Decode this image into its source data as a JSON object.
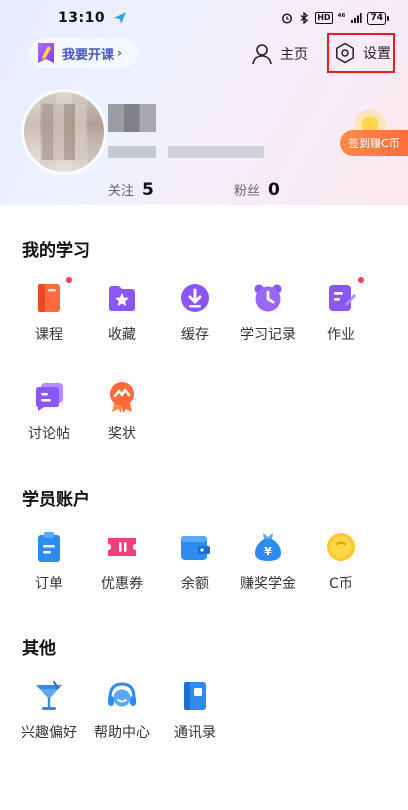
{
  "status_bar": {
    "time": "13:10",
    "hd": "HD",
    "signal": "⁴⁶",
    "battery": "74"
  },
  "header": {
    "teach_label": "我要开课",
    "home_label": "主页",
    "settings_label": "设置"
  },
  "profile": {
    "checkin_label": "签到赚C币",
    "follow_label": "关注",
    "follow_count": "5",
    "fans_label": "粉丝",
    "fans_count": "0"
  },
  "sections": [
    {
      "title": "我的学习",
      "items": [
        {
          "label": "课程",
          "icon": "course-book-icon",
          "badge": true
        },
        {
          "label": "收藏",
          "icon": "star-folder-icon",
          "badge": false
        },
        {
          "label": "缓存",
          "icon": "download-icon",
          "badge": false
        },
        {
          "label": "学习记录",
          "icon": "alarm-clock-icon",
          "badge": false
        },
        {
          "label": "作业",
          "icon": "homework-icon",
          "badge": true
        },
        {
          "label": "讨论帖",
          "icon": "chat-bubble-icon",
          "badge": false
        },
        {
          "label": "奖状",
          "icon": "medal-icon",
          "badge": false
        }
      ]
    },
    {
      "title": "学员账户",
      "items": [
        {
          "label": "订单",
          "icon": "clipboard-icon",
          "badge": false
        },
        {
          "label": "优惠券",
          "icon": "coupon-icon",
          "badge": false
        },
        {
          "label": "余额",
          "icon": "wallet-icon",
          "badge": false
        },
        {
          "label": "赚奖学金",
          "icon": "money-bag-icon",
          "badge": false
        },
        {
          "label": "C币",
          "icon": "coin-icon",
          "badge": false
        }
      ]
    },
    {
      "title": "其他",
      "items": [
        {
          "label": "兴趣偏好",
          "icon": "cocktail-icon",
          "badge": false
        },
        {
          "label": "帮助中心",
          "icon": "headset-icon",
          "badge": false
        },
        {
          "label": "通讯录",
          "icon": "contacts-book-icon",
          "badge": false
        }
      ]
    }
  ],
  "colors": {
    "accent": "#4a55c9",
    "highlight_box": "#e02020",
    "checkin": "#ff7a42",
    "badge": "#f0405a"
  }
}
